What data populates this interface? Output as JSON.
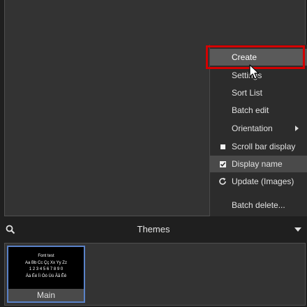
{
  "context_menu": {
    "items": [
      {
        "label": "Create",
        "icon": ""
      },
      {
        "label": "Settings",
        "icon": ""
      },
      {
        "label": "Sort List",
        "icon": ""
      },
      {
        "label": "Batch edit",
        "icon": ""
      },
      {
        "label": "Orientation",
        "icon": "chevron-right-icon",
        "submenu": true
      },
      {
        "label": "Scroll bar display",
        "icon": "checkbox-unchecked-icon",
        "checked": false
      },
      {
        "label": "Display name",
        "icon": "checkbox-checked-icon",
        "checked": true
      },
      {
        "label": "Update (Images)",
        "icon": "refresh-icon"
      },
      {
        "label": "Batch delete...",
        "icon": ""
      }
    ],
    "highlight_color": "#d40000"
  },
  "themes_bar": {
    "label": "Themes",
    "search_icon": "search-icon",
    "dropdown_icon": "dropdown-arrow-icon"
  },
  "theme_list": [
    {
      "name": "Main",
      "selected": true,
      "preview_lines": [
        "Font test",
        "Aa Bb Cc Çç Xx Yy Zz",
        "1 2 3 4 5 6 7 8 9 0",
        "Áá Éé Íí Óó Úú Ãã Êê"
      ]
    }
  ],
  "colors": {
    "selection_border": "#5a82c8",
    "panel_bg": "#333333",
    "app_bg": "#1f1f1f"
  }
}
